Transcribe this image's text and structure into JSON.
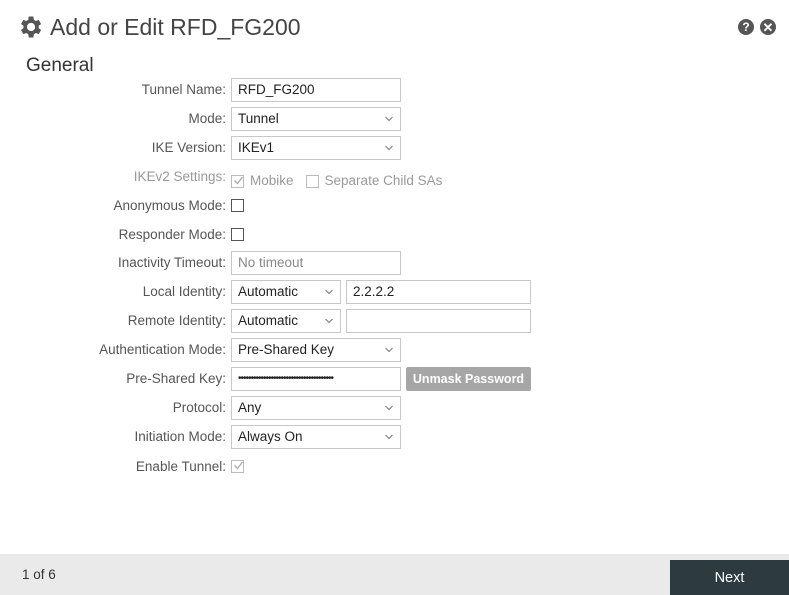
{
  "dialog": {
    "title": "Add or Edit RFD_FG200",
    "section": "General",
    "help_glyph": "?",
    "close_glyph": "✕"
  },
  "form": {
    "tunnel_name": {
      "label": "Tunnel Name:",
      "value": "RFD_FG200"
    },
    "mode": {
      "label": "Mode:",
      "value": "Tunnel"
    },
    "ike_version": {
      "label": "IKE Version:",
      "value": "IKEv1"
    },
    "ikev2_settings": {
      "label": "IKEv2 Settings:",
      "mobike": {
        "label": "Mobike",
        "checked": true,
        "disabled": true
      },
      "separate_child_sas": {
        "label": "Separate Child SAs",
        "checked": false,
        "disabled": true
      }
    },
    "anonymous_mode": {
      "label": "Anonymous Mode:",
      "checked": false
    },
    "responder_mode": {
      "label": "Responder Mode:",
      "checked": false
    },
    "inactivity_timeout": {
      "label": "Inactivity Timeout:",
      "placeholder": "No timeout"
    },
    "local_identity": {
      "label": "Local Identity:",
      "type": "Automatic",
      "value": "2.2.2.2"
    },
    "remote_identity": {
      "label": "Remote Identity:",
      "type": "Automatic",
      "value": ""
    },
    "authentication_mode": {
      "label": "Authentication Mode:",
      "value": "Pre-Shared Key"
    },
    "pre_shared_key": {
      "label": "Pre-Shared Key:",
      "masked_value": "••••••••••••••••••••••••••••••••••••••",
      "unmask_label": "Unmask Password"
    },
    "protocol": {
      "label": "Protocol:",
      "value": "Any"
    },
    "initiation_mode": {
      "label": "Initiation Mode:",
      "value": "Always On"
    },
    "enable_tunnel": {
      "label": "Enable Tunnel:",
      "checked": true,
      "disabled": true
    }
  },
  "footer": {
    "page_indicator": "1 of 6",
    "next_label": "Next"
  },
  "colors": {
    "footer_bg": "#eaeaea",
    "next_button_bg": "#2d3a40",
    "unmask_button_bg": "#a6a6a6"
  }
}
